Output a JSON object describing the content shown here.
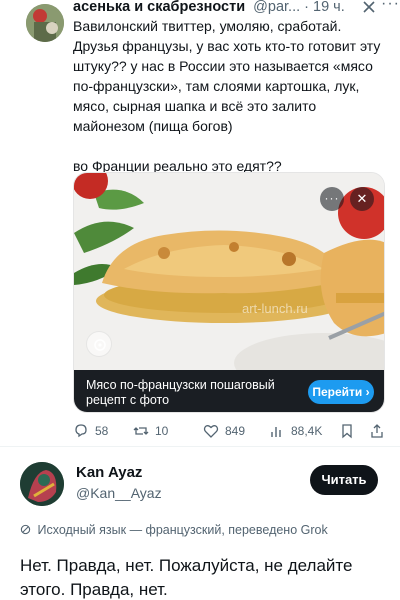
{
  "tweet1": {
    "author_name": "асенька и скабрезности",
    "handle_time": "@par... · 19 ч.",
    "more_glyph": "···",
    "text_lines": [
      "Вавилонский твиттер, умоляю, сработай.",
      "Друзья французы, у вас хоть кто-то готовит эту штуку?? у нас в России это называется «мясо по-французски», там слоями картошка, лук, мясо, сырная шапка и всё это залито майонезом (пища богов)"
    ],
    "question": "во Франции реально это едят??",
    "card": {
      "caption": "Мясо по-французски пошаговый рецепт с фото",
      "button_label": "Перейти ›",
      "more_glyph": "···",
      "close_glyph": "✕",
      "watermark": "art-lunch.ru"
    },
    "stats": {
      "replies": "58",
      "reposts": "10",
      "likes": "849",
      "views": "88,4K"
    },
    "colors": {
      "accent": "#1d9bf0",
      "muted": "#536471",
      "caption_bg": "#1a1e23"
    }
  },
  "tweet2": {
    "author_name": "Kan Ayaz",
    "handle": "@Kan__Ayaz",
    "follow_label": "Читать",
    "translation_note": "Исходный язык — французский, переведено Grok",
    "text": "Нет. Правда, нет. Пожалуйста, не делайте этого. Правда, нет."
  },
  "icons": [
    "x-logo-icon",
    "reply-icon",
    "repost-icon",
    "like-icon",
    "views-icon",
    "bookmark-icon",
    "share-icon",
    "grok-icon",
    "lens-icon"
  ]
}
